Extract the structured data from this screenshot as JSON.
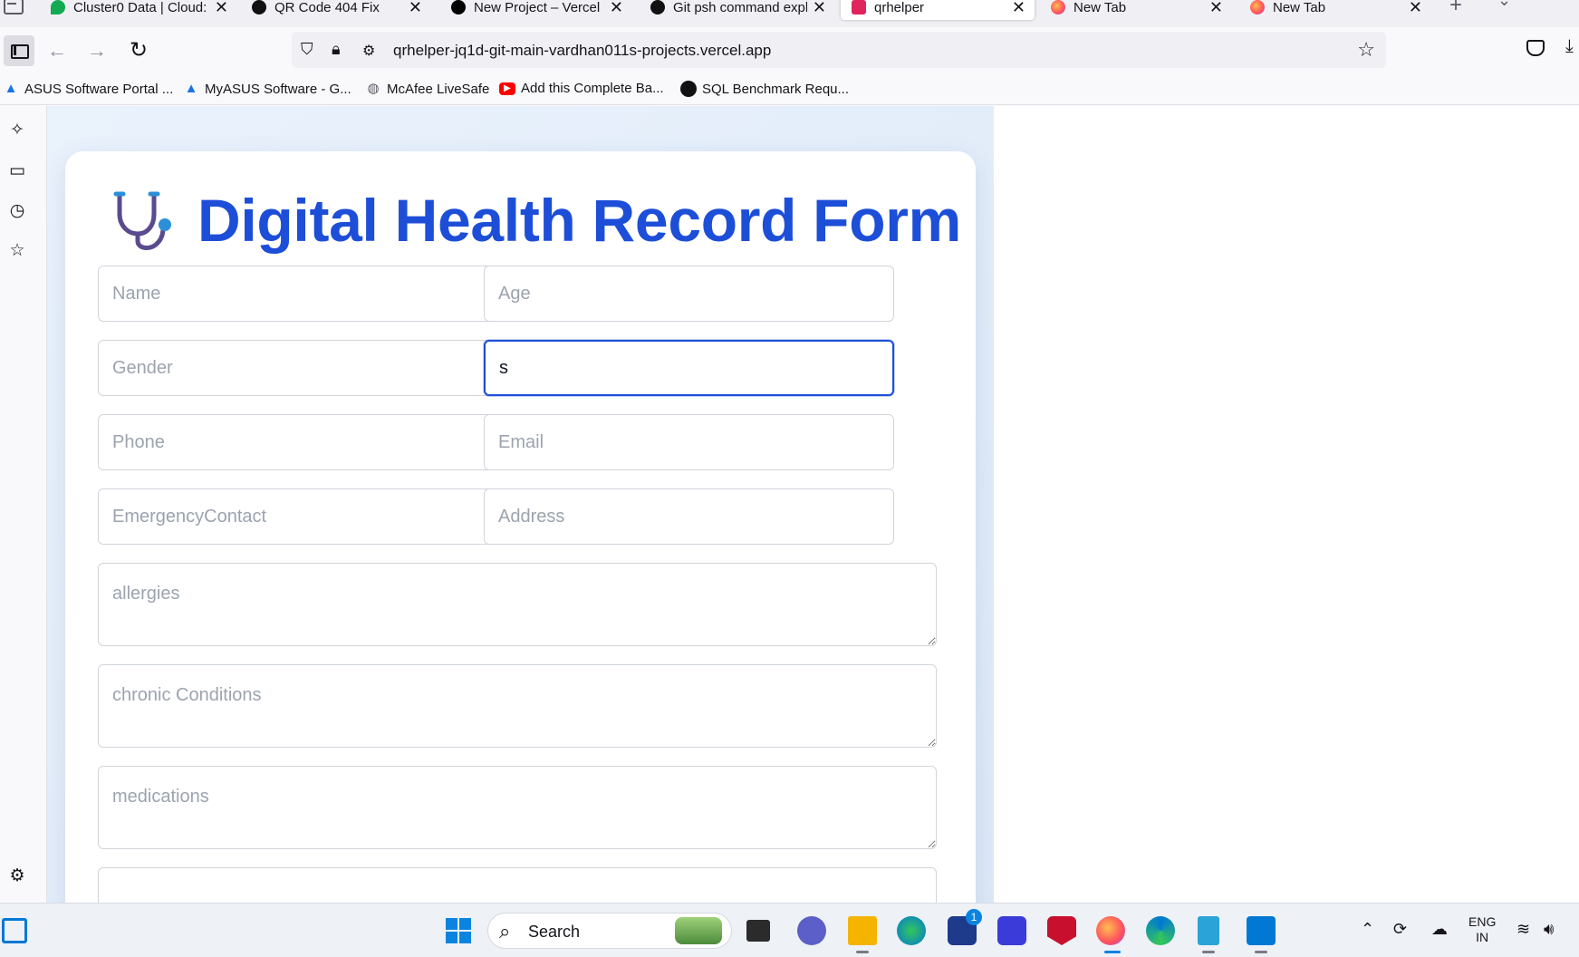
{
  "browser": {
    "tabs": [
      {
        "title": "Cluster0 Data | Cloud:",
        "favicon": "mongodb-leaf",
        "color": "#13aa52",
        "active": false
      },
      {
        "title": "QR Code 404 Fix",
        "favicon": "chatgpt",
        "color": "#111111",
        "active": false
      },
      {
        "title": "New Project – Vercel",
        "favicon": "vercel",
        "color": "#000000",
        "active": false
      },
      {
        "title": "Git psh command expl",
        "favicon": "chatgpt",
        "color": "#111111",
        "active": false
      },
      {
        "title": "qrhelper",
        "favicon": "qrhelper",
        "color": "#e0245e",
        "active": true
      },
      {
        "title": "New Tab",
        "favicon": "firefox",
        "color": "#ff7139",
        "active": false
      },
      {
        "title": "New Tab",
        "favicon": "firefox",
        "color": "#ff7139",
        "active": false
      }
    ],
    "url": "qrhelper-jq1d-git-main-vardhan011s-projects.vercel.app",
    "bookmarks": [
      {
        "label": "ASUS Software Portal ...",
        "icon": "asus-icon"
      },
      {
        "label": "MyASUS Software - G...",
        "icon": "asus-icon"
      },
      {
        "label": "McAfee LiveSafe",
        "icon": "globe-icon"
      },
      {
        "label": "Add this Complete Ba...",
        "icon": "youtube-icon"
      },
      {
        "label": "SQL Benchmark Requ...",
        "icon": "chatgpt-icon"
      }
    ]
  },
  "form": {
    "title": "Digital Health Record Form",
    "fields": {
      "name": {
        "placeholder": "Name",
        "value": ""
      },
      "age": {
        "placeholder": "Age",
        "value": ""
      },
      "gender": {
        "placeholder": "Gender",
        "value": ""
      },
      "blood_group": {
        "placeholder": "",
        "value": "s"
      },
      "phone": {
        "placeholder": "Phone",
        "value": ""
      },
      "email": {
        "placeholder": "Email",
        "value": ""
      },
      "emergency_contact": {
        "placeholder": "EmergencyContact",
        "value": ""
      },
      "address": {
        "placeholder": "Address",
        "value": ""
      },
      "allergies": {
        "placeholder": "allergies",
        "value": ""
      },
      "chronic_conditions": {
        "placeholder": "chronic Conditions",
        "value": ""
      },
      "medications": {
        "placeholder": "medications",
        "value": ""
      }
    }
  },
  "taskbar": {
    "search_label": "Search",
    "language": "ENG",
    "region": "IN",
    "store_badge": "1"
  },
  "colors": {
    "title_blue": "#1d4ed8",
    "focus_border": "#1d4ed8",
    "page_bg": "#eaf2fc"
  }
}
